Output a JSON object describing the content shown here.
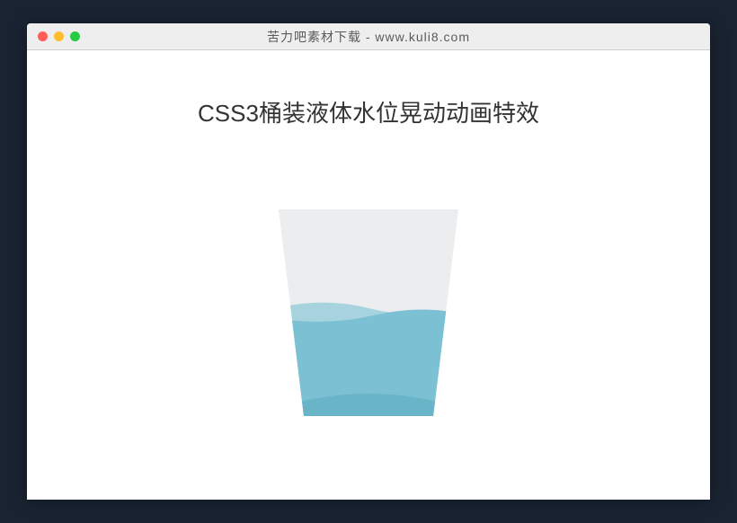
{
  "window": {
    "title": "苦力吧素材下载 - www.kuli8.com"
  },
  "content": {
    "heading": "CSS3桶装液体水位晃动动画特效"
  },
  "cup": {
    "colors": {
      "glass": "#ecedef",
      "water_back": "#a7d3df",
      "water_front": "#7cc0d3",
      "water_bottom": "#5facc2"
    }
  }
}
